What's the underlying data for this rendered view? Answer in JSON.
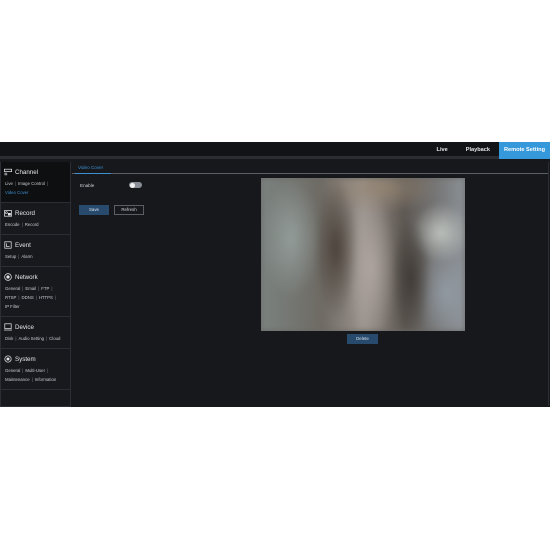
{
  "topnav": {
    "items": [
      {
        "label": "Live",
        "active": false
      },
      {
        "label": "Playback",
        "active": false
      },
      {
        "label": "Remote Setting",
        "active": true
      }
    ]
  },
  "sidebar": {
    "groups": [
      {
        "title": "Channel",
        "icon": "channel-icon",
        "links": [
          "Live",
          "Image Control",
          "Video Cover"
        ],
        "selected": "Video Cover"
      },
      {
        "title": "Record",
        "icon": "record-icon",
        "links": [
          "Encode",
          "Record"
        ]
      },
      {
        "title": "Event",
        "icon": "event-icon",
        "links": [
          "Setup",
          "Alarm"
        ]
      },
      {
        "title": "Network",
        "icon": "network-icon",
        "links": [
          "General",
          "Email",
          "FTP",
          "RTSP",
          "DDNS",
          "HTTPS",
          "IP Filter"
        ]
      },
      {
        "title": "Device",
        "icon": "device-icon",
        "links": [
          "Disk",
          "Audio Setting",
          "Cloud"
        ]
      },
      {
        "title": "System",
        "icon": "system-icon",
        "links": [
          "General",
          "Multi-User",
          "Maintenance",
          "Information"
        ]
      }
    ]
  },
  "main": {
    "tab": "Video Cover",
    "enable_label": "Enable",
    "enable_on": false,
    "save_label": "Save",
    "refresh_label": "Refresh",
    "delete_label": "Delete"
  },
  "colors": {
    "accent": "#3598db",
    "button": "#274a6d",
    "background": "#16181c"
  }
}
